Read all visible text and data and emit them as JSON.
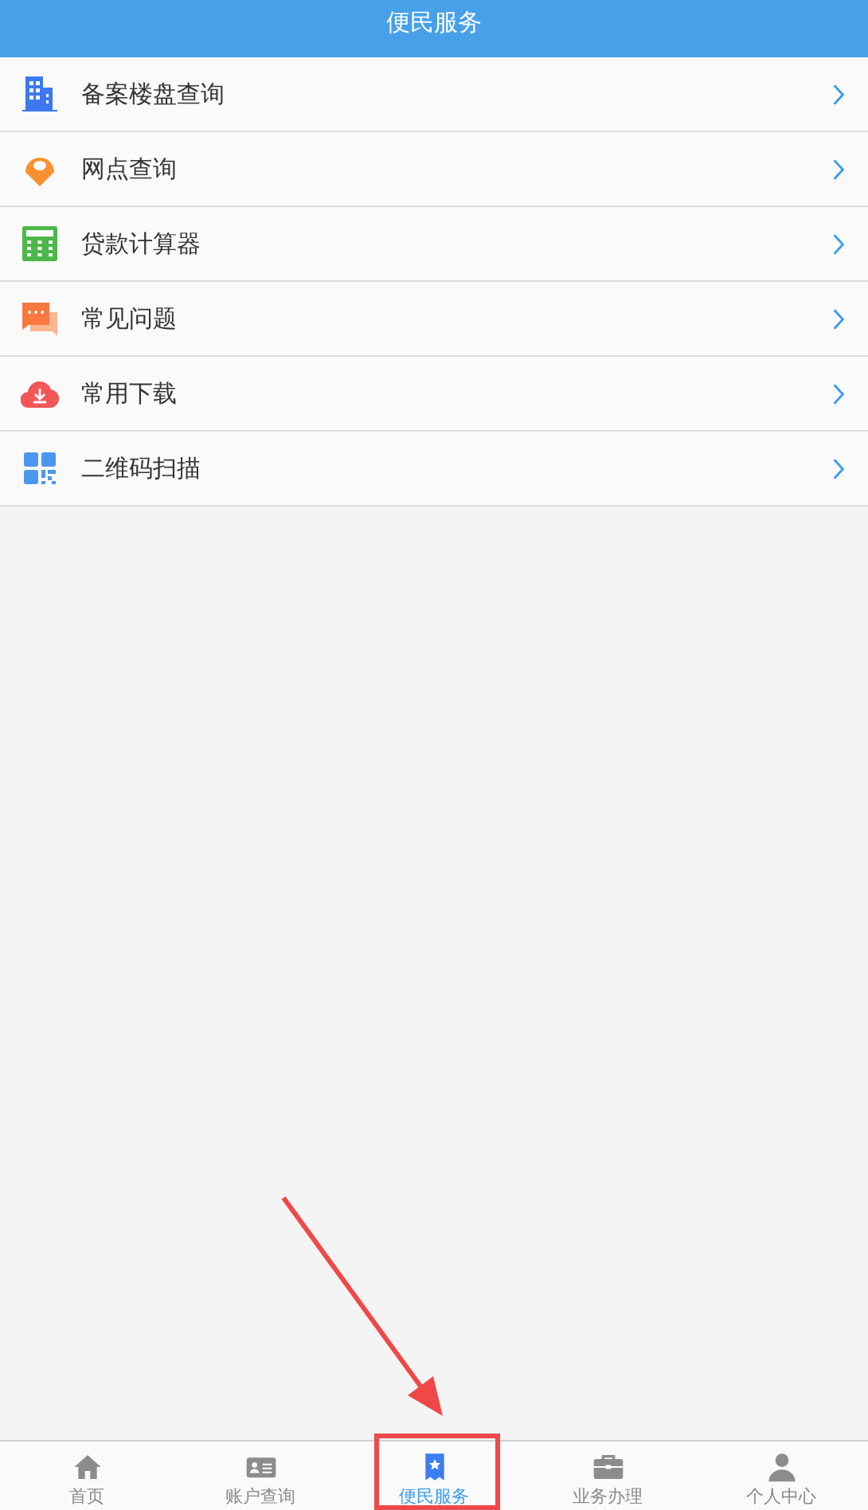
{
  "header": {
    "title": "便民服务"
  },
  "menu": [
    {
      "kind": "building",
      "label": "备案楼盘查询"
    },
    {
      "kind": "pin",
      "label": "网点查询"
    },
    {
      "kind": "calculator",
      "label": "贷款计算器"
    },
    {
      "kind": "chat",
      "label": "常见问题"
    },
    {
      "kind": "download",
      "label": "常用下载"
    },
    {
      "kind": "qr",
      "label": "二维码扫描"
    }
  ],
  "tabs": [
    {
      "kind": "home",
      "label": "首页",
      "selected": false
    },
    {
      "kind": "card",
      "label": "账户查询",
      "selected": false
    },
    {
      "kind": "bookmark",
      "label": "便民服务",
      "selected": true
    },
    {
      "kind": "briefcase",
      "label": "业务办理",
      "selected": false
    },
    {
      "kind": "person",
      "label": "个人中心",
      "selected": false
    }
  ]
}
